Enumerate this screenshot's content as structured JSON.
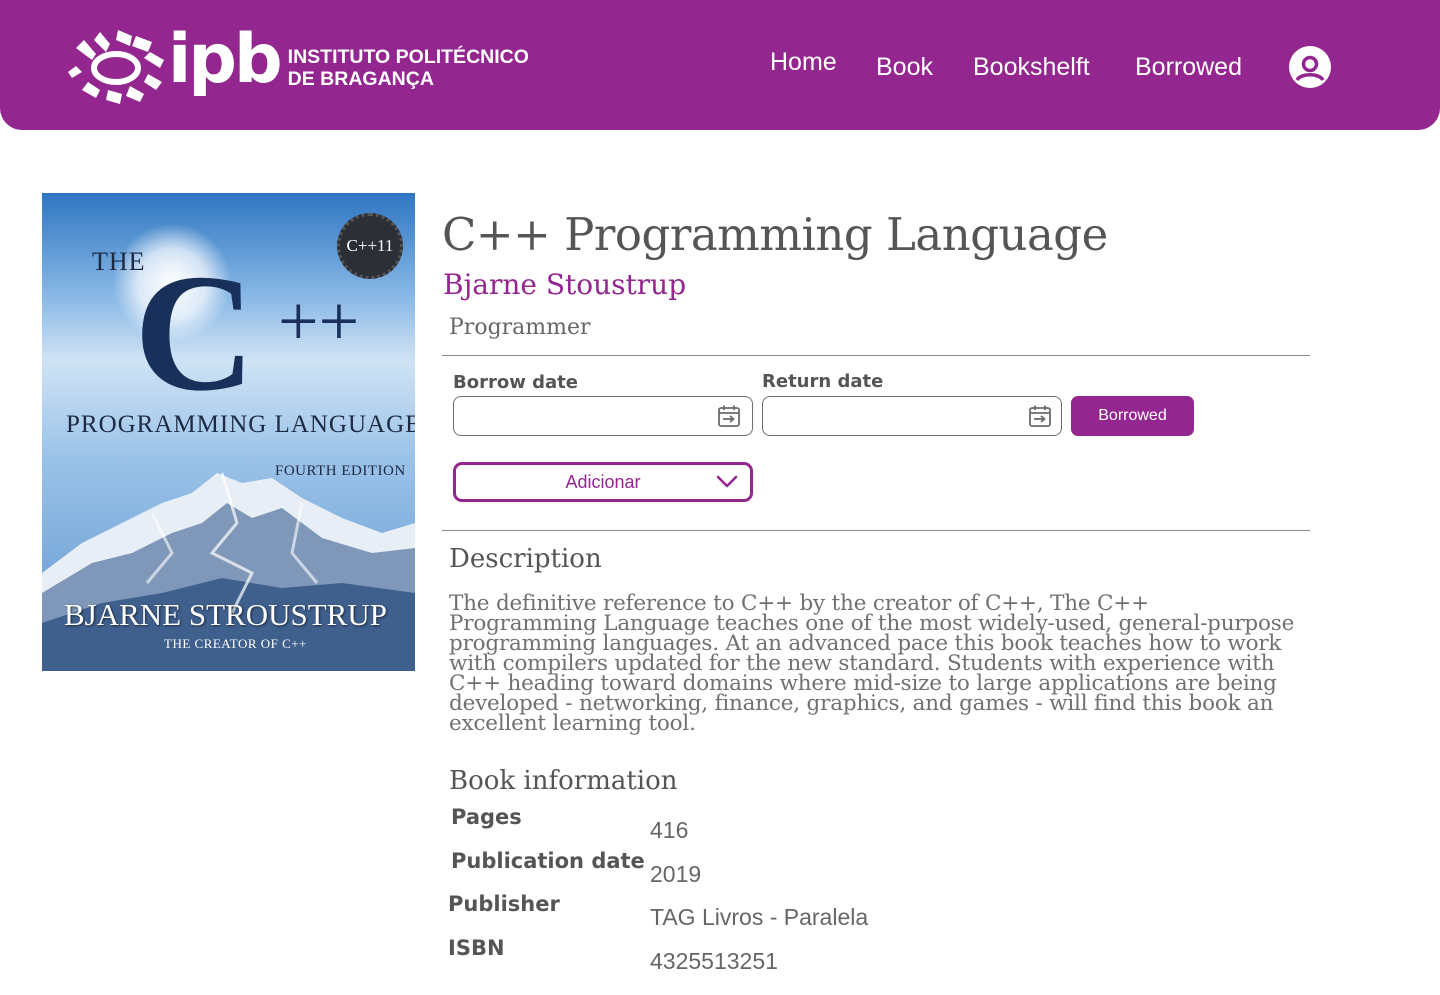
{
  "header": {
    "logo": {
      "mark": "ipb",
      "line1": "INSTITUTO POLITÉCNICO",
      "line2": "DE BRAGANÇA"
    },
    "nav": [
      "Home",
      "Book",
      "Bookshelft",
      "Borrowed"
    ],
    "profile_icon": "user-circle-icon"
  },
  "cover": {
    "the": "THE",
    "c": "C",
    "plusplus": "++",
    "subtitle": "PROGRAMMING LANGUAGE",
    "edition": "FOURTH EDITION",
    "badge": "C++11",
    "author": "BJARNE STROUSTRUP",
    "tagline": "THE CREATOR OF C++"
  },
  "book": {
    "title": "C++ Programming Language",
    "author": "Bjarne Stoustrup",
    "category": "Programmer"
  },
  "borrow": {
    "borrow_date_label": "Borrow date",
    "borrow_date_value": "",
    "return_date_label": "Return date",
    "return_date_value": "",
    "calendar_icon": "calendar-icon",
    "status_button": "Borrowed",
    "shelf_select": "Adicionar"
  },
  "description": {
    "heading": "Description",
    "text": "The definitive reference to C++ by the creator of C++, The C++ Programming Language teaches one of the most widely-used, general-purpose programming languages. At an advanced pace this book teaches how to work with compilers updated for the new standard. Students with experience with C++ heading toward domains where mid-size to large applications are being developed - networking, finance, graphics, and games - will find this book an excellent learning tool."
  },
  "info": {
    "heading": "Book information",
    "rows": [
      {
        "label": "Pages",
        "value": "416"
      },
      {
        "label": "Publication date",
        "value": "2019"
      },
      {
        "label": "Publisher",
        "value": "TAG Livros - Paralela"
      },
      {
        "label": "ISBN",
        "value": "4325513251"
      }
    ]
  },
  "colors": {
    "brand": "#93268f",
    "text": "#555555"
  }
}
